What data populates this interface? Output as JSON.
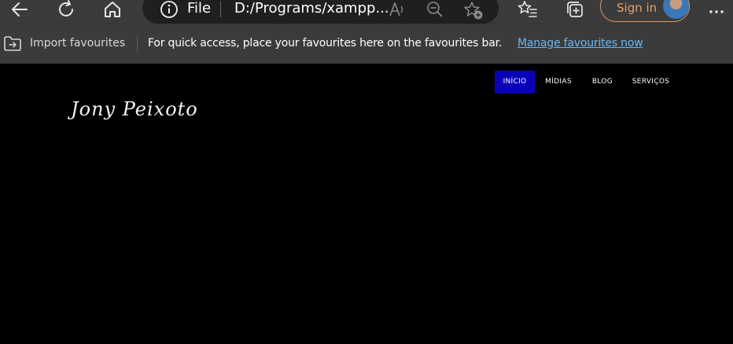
{
  "browser": {
    "address": {
      "scheme_label": "File",
      "url": "D:/Programs/xampp..."
    },
    "signin_label": "Sign in",
    "icons": {
      "back": "back-arrow-icon",
      "refresh": "refresh-icon",
      "home": "home-icon",
      "info": "info-icon",
      "read_aloud": "read-aloud-icon",
      "zoom": "zoom-out-icon",
      "add_favourite": "add-favourite-icon",
      "favourites": "favourites-icon",
      "collections": "collections-icon",
      "more": "more-icon"
    }
  },
  "favourites_bar": {
    "import_label": "Import favourites",
    "message": "For quick access, place your favourites here on the favourites bar.",
    "manage_link": "Manage favourites now"
  },
  "site": {
    "logo_text": "Jony Peixoto",
    "nav": [
      {
        "label": "INÍCIO",
        "active": true
      },
      {
        "label": "MÍDIAS",
        "active": false
      },
      {
        "label": "BLOG",
        "active": false
      },
      {
        "label": "SERVIÇOS",
        "active": false
      }
    ],
    "colors": {
      "active_nav_bg": "#0a00b8",
      "page_bg": "#000000"
    }
  }
}
